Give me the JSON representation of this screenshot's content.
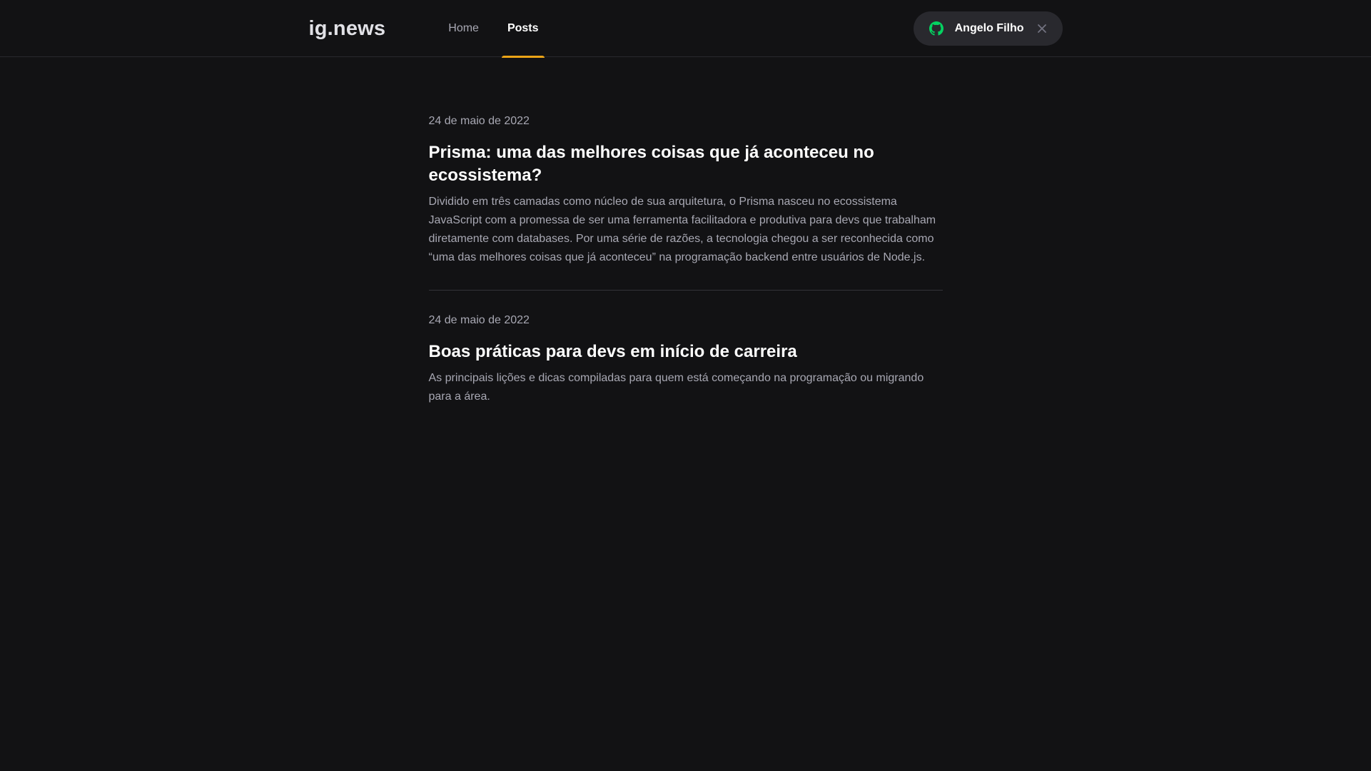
{
  "header": {
    "logo": "ig.news",
    "nav": [
      {
        "label": "Home",
        "active": false
      },
      {
        "label": "Posts",
        "active": true
      }
    ],
    "user": {
      "name": "Angelo Filho",
      "icon": "github-icon",
      "close_icon": "close-icon"
    }
  },
  "posts": [
    {
      "date": "24 de maio de 2022",
      "title": "Prisma: uma das melhores coisas que já aconteceu no ecossistema?",
      "excerpt": "Dividido em três camadas como núcleo de sua arquitetura, o Prisma nasceu no ecossistema JavaScript com a promessa de ser uma ferramenta facilitadora e produtiva para devs que trabalham diretamente com databases. Por uma série de razões, a tecnologia chegou a ser reconhecida como “uma das melhores coisas que já aconteceu” na programação backend entre usuários de Node.js."
    },
    {
      "date": "24 de maio de 2022",
      "title": "Boas práticas para devs em início de carreira",
      "excerpt": "As principais lições e dicas compiladas para quem está começando na programação ou migrando para a área."
    }
  ],
  "colors": {
    "background": "#121214",
    "accent": "#eba417",
    "github_green": "#04d361"
  }
}
